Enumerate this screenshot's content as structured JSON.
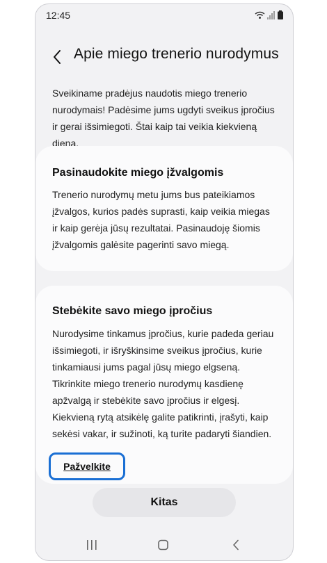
{
  "status_bar": {
    "time": "12:45"
  },
  "header": {
    "title": "Apie miego trenerio nurodymus"
  },
  "intro": "Sveikiname pradėjus naudotis miego trenerio nurodymais! Padėsime jums ugdyti sveikus įpročius ir gerai išsimiegoti. Štai kaip tai veikia kiekvieną dieną.",
  "cards": [
    {
      "title": "Pasinaudokite miego įžvalgomis",
      "text": "Trenerio nurodymų metu jums bus pateikiamos įžvalgos, kurios padės suprasti, kaip veikia miegas ir kaip gerėja jūsų rezultatai. Pasinaudoję šiomis įžvalgomis galėsite pagerinti savo miegą."
    },
    {
      "title": "Stebėkite savo miego įpročius",
      "text": "Nurodysime tinkamus įpročius, kurie padeda geriau išsimiegoti, ir išryškinsime sveikus įpročius, kurie tinkamiausi jums pagal jūsų miego elgseną. Tikrinkite miego trenerio nurodymų kasdienę apžvalgą ir stebėkite savo įpročius ir elgesį. Kiekvieną rytą atsikėlę galite patikrinti, įrašyti, kaip sekėsi vakar, ir sužinoti, ką turite padaryti šiandien."
    }
  ],
  "link_label": "Pažvelkite",
  "next_label": "Kitas",
  "colors": {
    "highlight": "#1a6fd4",
    "background": "#f2f2f4"
  }
}
